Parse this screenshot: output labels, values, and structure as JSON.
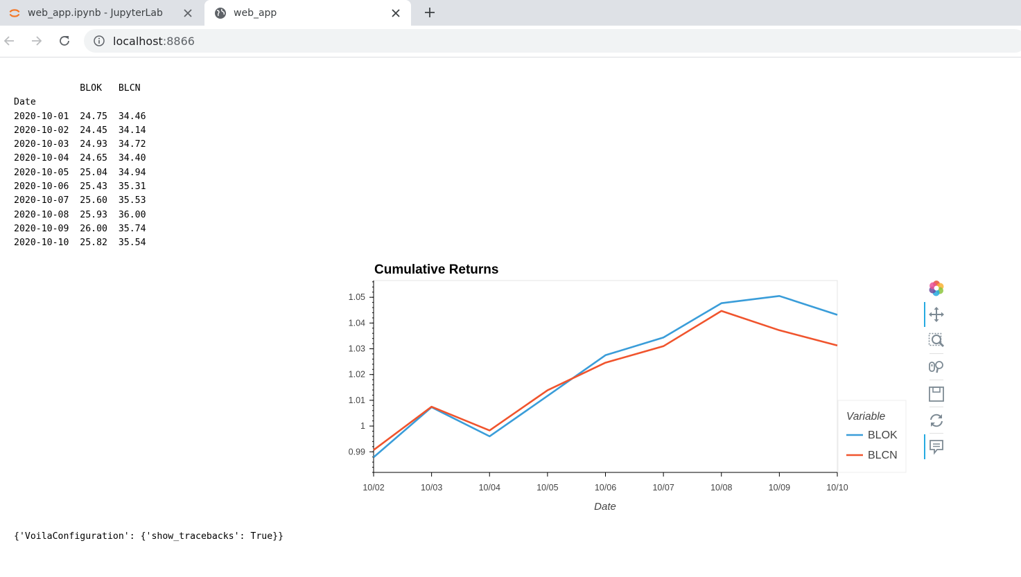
{
  "browser": {
    "tabs": [
      {
        "title": "web_app.ipynb - JupyterLab",
        "favicon": "jupyter-icon",
        "active": false
      },
      {
        "title": "web_app",
        "favicon": "globe-icon",
        "active": true
      }
    ],
    "address": {
      "host": "localhost",
      "port": ":8866"
    }
  },
  "dataframe": {
    "header": "            BLOK   BLCN",
    "index_name": "Date",
    "rows": [
      "2020-10-01  24.75  34.46",
      "2020-10-02  24.45  34.14",
      "2020-10-03  24.93  34.72",
      "2020-10-04  24.65  34.40",
      "2020-10-05  25.04  34.94",
      "2020-10-06  25.43  35.31",
      "2020-10-07  25.60  35.53",
      "2020-10-08  25.93  36.00",
      "2020-10-09  26.00  35.74",
      "2020-10-10  25.82  35.54"
    ]
  },
  "chart_data": {
    "type": "line",
    "title": "Cumulative Returns",
    "xlabel": "Date",
    "ylabel": "",
    "categories": [
      "10/02",
      "10/03",
      "10/04",
      "10/05",
      "10/06",
      "10/07",
      "10/08",
      "10/09",
      "10/10"
    ],
    "y_ticks": [
      "0.99",
      "1",
      "1.01",
      "1.02",
      "1.03",
      "1.04",
      "1.05"
    ],
    "ylim": [
      0.982,
      1.0565
    ],
    "grid": false,
    "legend": {
      "title": "Variable",
      "position": "bottom-right"
    },
    "series": [
      {
        "name": "BLOK",
        "color": "#3a9dd9",
        "values": [
          0.9879,
          1.0073,
          0.996,
          1.0117,
          1.0275,
          1.0344,
          1.0477,
          1.0505,
          1.0432
        ]
      },
      {
        "name": "BLCN",
        "color": "#f0542d",
        "values": [
          0.9907,
          1.0075,
          0.9983,
          1.0139,
          1.0246,
          1.031,
          1.0447,
          1.0372,
          1.0313
        ]
      }
    ]
  },
  "bokeh_toolbar": {
    "tools": [
      "bokeh-logo-icon",
      "pan-icon",
      "box-zoom-icon",
      "wheel-zoom-icon",
      "save-icon",
      "reset-icon",
      "hover-icon"
    ]
  },
  "voila_config": "{'VoilaConfiguration': {'show_tracebacks': True}}"
}
